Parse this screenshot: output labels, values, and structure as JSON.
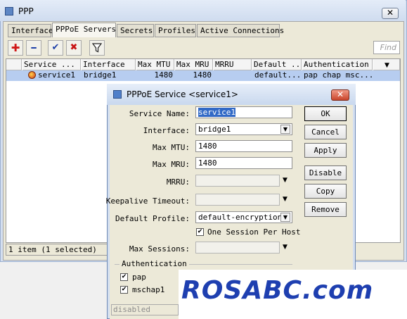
{
  "window": {
    "title": "PPP",
    "close_glyph": "✕"
  },
  "tabs": [
    {
      "label": "Interface"
    },
    {
      "label": "PPPoE Servers",
      "active": true
    },
    {
      "label": "Secrets"
    },
    {
      "label": "Profiles"
    },
    {
      "label": "Active Connections"
    }
  ],
  "toolbar": {
    "add_glyph": "✚",
    "remove_glyph": "━",
    "enable_glyph": "✔",
    "disable_glyph": "✖",
    "filter_glyph": "⏷",
    "find_placeholder": "Find",
    "colors": {
      "add": "#d01818",
      "remove": "#1d3fa8",
      "enable": "#1d3fa8",
      "disable": "#c81414"
    }
  },
  "table": {
    "columns": [
      "Service ... /",
      "Interface",
      "Max MTU",
      "Max MRU",
      "MRRU",
      "Default ...",
      "Authentication"
    ],
    "rows": [
      {
        "service": "service1",
        "interface": "bridge1",
        "max_mtu": "1480",
        "max_mru": "1480",
        "mrru": "",
        "default_profile": "default...",
        "authentication": "pap chap msc..."
      }
    ]
  },
  "status_bar": {
    "text": "1 item (1 selected)"
  },
  "dialog": {
    "title": "PPPoE Service <service1>",
    "close_glyph": "✕",
    "fields": {
      "service_name_label": "Service Name:",
      "service_name": "service1",
      "interface_label": "Interface:",
      "interface": "bridge1",
      "max_mtu_label": "Max MTU:",
      "max_mtu": "1480",
      "max_mru_label": "Max MRU:",
      "max_mru": "1480",
      "mrru_label": "MRRU:",
      "mrru": "",
      "keepalive_label": "Keepalive Timeout:",
      "keepalive": "",
      "default_profile_label": "Default Profile:",
      "default_profile": "default-encryption",
      "one_session_label": "One Session Per Host",
      "max_sessions_label": "Max Sessions:",
      "max_sessions": ""
    },
    "authentication_label": "Authentication",
    "auth_options": [
      {
        "label": "pap",
        "checked": true
      },
      {
        "label": "mschap1",
        "checked": true
      }
    ],
    "buttons": {
      "ok": "OK",
      "cancel": "Cancel",
      "apply": "Apply",
      "disable": "Disable",
      "copy": "Copy",
      "remove": "Remove"
    },
    "status": "disabled"
  },
  "watermark": {
    "text": "ROSABC.com"
  }
}
